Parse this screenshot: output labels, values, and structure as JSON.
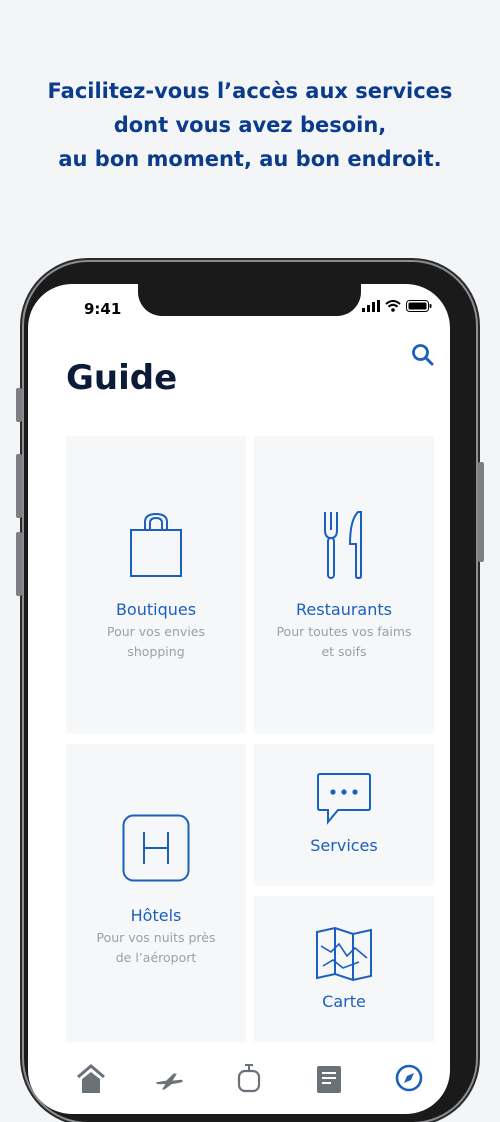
{
  "promo": {
    "line1": "Facilitez-vous l’accès aux services",
    "line2": "dont vous avez besoin,",
    "line3": "au bon moment, au bon endroit."
  },
  "status": {
    "time": "9:41"
  },
  "header": {
    "title": "Guide",
    "search_icon": "search-icon"
  },
  "tiles": [
    {
      "id": "boutiques",
      "label": "Boutiques",
      "sub1": "Pour vos envies",
      "sub2": "shopping",
      "icon": "shopping-bag-icon"
    },
    {
      "id": "restaurants",
      "label": "Restaurants",
      "sub1": "Pour toutes vos faims",
      "sub2": "et soifs",
      "icon": "fork-knife-icon"
    },
    {
      "id": "hotels",
      "label": "Hôtels",
      "sub1": "Pour vos nuits près",
      "sub2": "de l’aéroport",
      "icon": "hotel-icon"
    },
    {
      "id": "services",
      "label": "Services",
      "icon": "chat-bubble-icon"
    },
    {
      "id": "carte",
      "label": "Carte",
      "icon": "map-icon"
    }
  ],
  "tabbar": {
    "items": [
      {
        "name": "home",
        "icon": "home-icon"
      },
      {
        "name": "flights",
        "icon": "plane-icon"
      },
      {
        "name": "transport",
        "icon": "train-icon"
      },
      {
        "name": "news",
        "icon": "document-icon"
      },
      {
        "name": "guide",
        "icon": "compass-icon"
      }
    ]
  },
  "colors": {
    "accent": "#1b5fbf",
    "promo_text": "#0b3c8c",
    "title": "#0d1b3a",
    "tile_bg": "#f6f7f8",
    "subtitle": "#9aa1a8"
  }
}
